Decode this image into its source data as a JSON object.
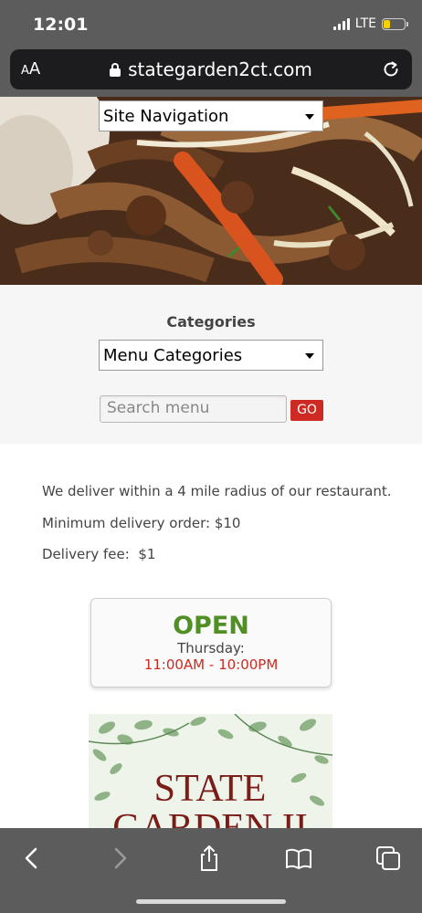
{
  "status_bar": {
    "time": "12:01",
    "network": "LTE",
    "battery_level": 0.3
  },
  "browser": {
    "text_size_label_small": "A",
    "text_size_label_large": "A",
    "url": "stategarden2ct.com",
    "icons": [
      "lock-icon",
      "reload-icon",
      "back-icon",
      "forward-icon",
      "share-icon",
      "bookmarks-icon",
      "tabs-icon"
    ]
  },
  "site_navigation": {
    "selected": "Site Navigation"
  },
  "categories": {
    "title": "Categories",
    "selected": "Menu Categories",
    "search_placeholder": "Search menu",
    "go_label": "GO"
  },
  "delivery": {
    "radius_text": "We deliver within a 4 mile radius of our restaurant.",
    "minimum_text": "Minimum delivery order: $10",
    "fee_text": "Delivery fee:  $1"
  },
  "hours": {
    "status": "OPEN",
    "day": "Thursday:",
    "time": "11:00AM - 10:00PM"
  },
  "logo": {
    "line1": "STATE",
    "line2": "GARDEN II"
  },
  "colors": {
    "accent_red": "#cc2a22",
    "open_green": "#4f8f23",
    "chrome_gray": "#5c5c5c"
  }
}
